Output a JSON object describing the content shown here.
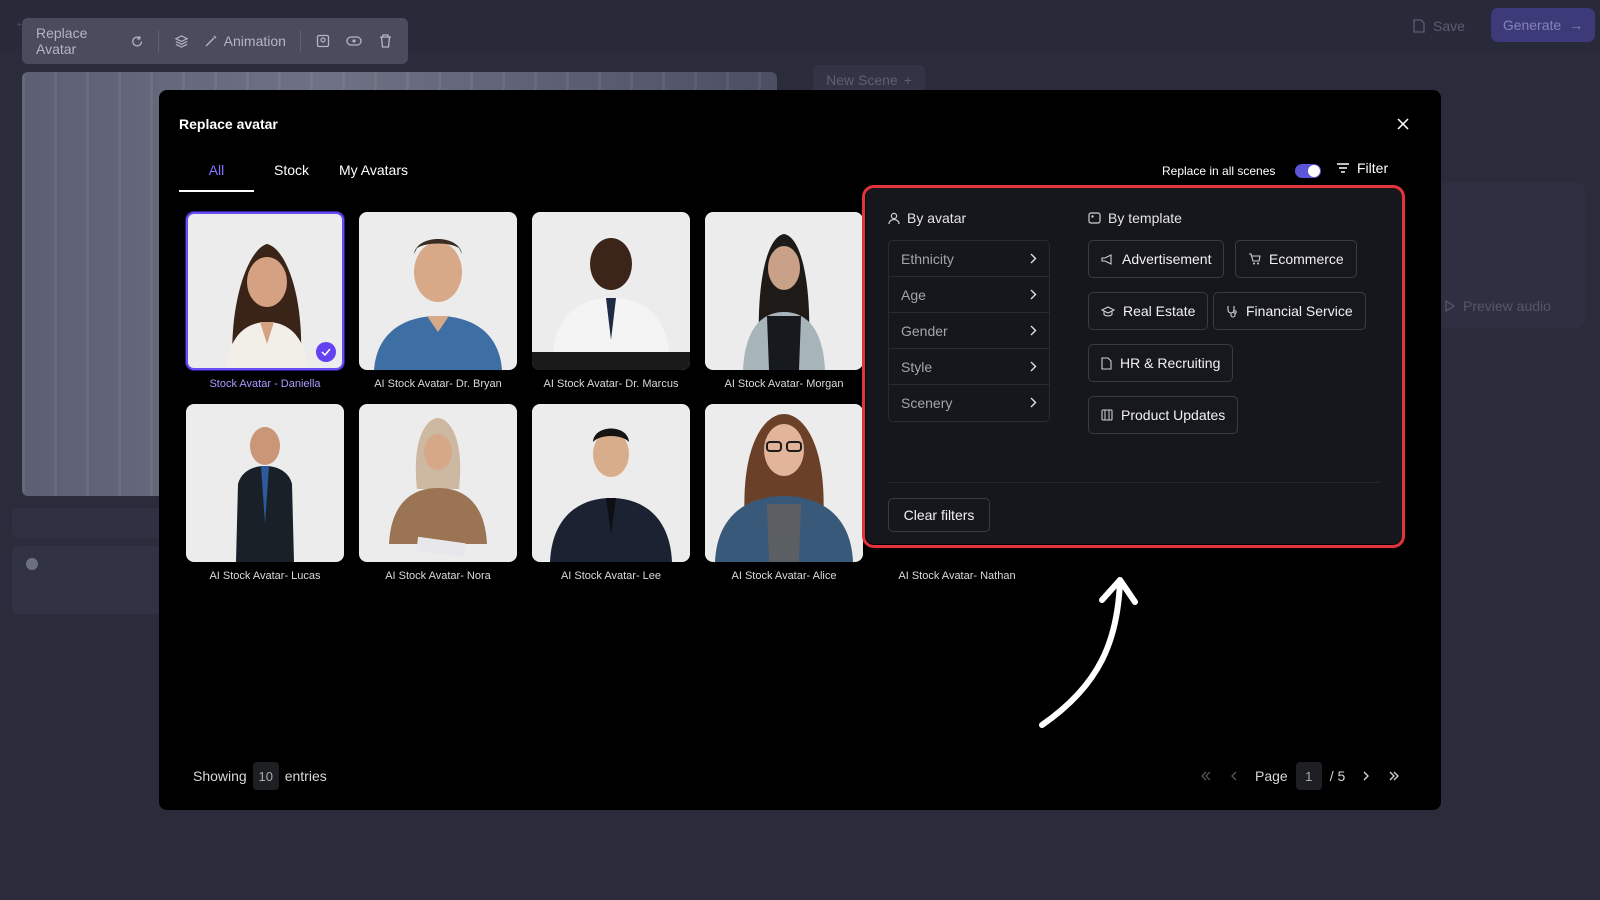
{
  "topbar": {
    "save_label": "Save",
    "generate_label": "Generate"
  },
  "toolbar": {
    "replace_avatar_label": "Replace Avatar",
    "animation_label": "Animation"
  },
  "background": {
    "new_scene_label": "New Scene",
    "preview_audio_label": "Preview audio"
  },
  "modal": {
    "title": "Replace avatar",
    "tabs": [
      {
        "label": "All"
      },
      {
        "label": "Stock"
      },
      {
        "label": "My Avatars"
      }
    ],
    "replace_in_all_scenes_label": "Replace in all scenes",
    "replace_in_all_scenes_on": true,
    "filter_label": "Filter"
  },
  "avatars": [
    {
      "label": "Stock Avatar - Daniella",
      "selected": true
    },
    {
      "label": "AI Stock Avatar- Dr. Bryan",
      "selected": false
    },
    {
      "label": "AI Stock Avatar- Dr. Marcus",
      "selected": false
    },
    {
      "label": "AI Stock Avatar- Morgan",
      "selected": false
    },
    {
      "label": "AI Stock Avatar- Lucas",
      "selected": false
    },
    {
      "label": "AI Stock Avatar- Nora",
      "selected": false
    },
    {
      "label": "AI Stock Avatar- Lee",
      "selected": false
    },
    {
      "label": "AI Stock Avatar- Alice",
      "selected": false
    },
    {
      "label": "AI Stock Avatar- Nathan",
      "selected": false
    }
  ],
  "filter_panel": {
    "by_avatar_label": "By avatar",
    "avatar_filters": [
      {
        "label": "Ethnicity"
      },
      {
        "label": "Age"
      },
      {
        "label": "Gender"
      },
      {
        "label": "Style"
      },
      {
        "label": "Scenery"
      }
    ],
    "by_template_label": "By template",
    "templates": [
      {
        "label": "Advertisement",
        "icon": "megaphone-icon"
      },
      {
        "label": "Ecommerce",
        "icon": "cart-icon"
      },
      {
        "label": "Real Estate",
        "icon": "graduation-cap-icon"
      },
      {
        "label": "Financial Service",
        "icon": "stethoscope-icon"
      },
      {
        "label": "HR & Recruiting",
        "icon": "document-icon"
      },
      {
        "label": "Product Updates",
        "icon": "film-icon"
      }
    ],
    "clear_label": "Clear filters"
  },
  "footer": {
    "showing_label": "Showing",
    "entries_value": "10",
    "entries_label": "entries",
    "page_label": "Page",
    "current_page": "1",
    "total_pages_label": "/ 5"
  },
  "colors": {
    "accent": "#6b4cf5",
    "highlight_border": "#e3343c",
    "modal_bg": "#000000"
  }
}
